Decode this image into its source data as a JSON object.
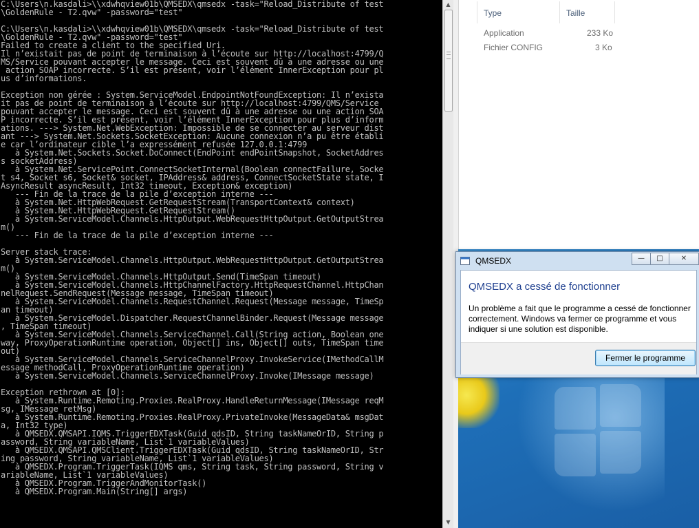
{
  "console": {
    "lines": [
      "C:\\Users\\n.kasdali>\\\\xdwhqview01b\\QMSEDX\\qmsedx -task=\"Reload_Distribute of test",
      "\\GoldenRule - T2.qvw\" -password=\"test\"",
      "",
      "C:\\Users\\n.kasdali>\\\\xdwhqview01b\\QMSEDX\\qmsedx -task=\"Reload_Distribute of test",
      "\\GoldenRule - T2.qvw\" -password=\"test\"",
      "Failed to create a client to the specified Uri.",
      "Il n’existait pas de point de terminaison à l’écoute sur http://localhost:4799/Q",
      "MS/Service pouvant accepter le message. Ceci est souvent dû à une adresse ou une",
      " action SOAP incorrecte. S’il est présent, voir l’élément InnerException pour pl",
      "us d’informations.",
      "",
      "Exception non gérée : System.ServiceModel.EndpointNotFoundException: Il n’exista",
      "it pas de point de terminaison à l’écoute sur http://localhost:4799/QMS/Service",
      "pouvant accepter le message. Ceci est souvent dû à une adresse ou une action SOA",
      "P incorrecte. S’il est présent, voir l’élément InnerException pour plus d’inform",
      "ations. ---> System.Net.WebException: Impossible de se connecter au serveur dist",
      "ant ---> System.Net.Sockets.SocketException: Aucune connexion n’a pu être établi",
      "e car l’ordinateur cible l’a expressément refusée 127.0.0.1:4799",
      "   à System.Net.Sockets.Socket.DoConnect(EndPoint endPointSnapshot, SocketAddres",
      "s socketAddress)",
      "   à System.Net.ServicePoint.ConnectSocketInternal(Boolean connectFailure, Socke",
      "t s4, Socket s6, Socket& socket, IPAddress& address, ConnectSocketState state, I",
      "AsyncResult asyncResult, Int32 timeout, Exception& exception)",
      "   --- Fin de la trace de la pile d’exception interne ---",
      "   à System.Net.HttpWebRequest.GetRequestStream(TransportContext& context)",
      "   à System.Net.HttpWebRequest.GetRequestStream()",
      "   à System.ServiceModel.Channels.HttpOutput.WebRequestHttpOutput.GetOutputStrea",
      "m()",
      "   --- Fin de la trace de la pile d’exception interne ---",
      "",
      "Server stack trace:",
      "   à System.ServiceModel.Channels.HttpOutput.WebRequestHttpOutput.GetOutputStrea",
      "m()",
      "   à System.ServiceModel.Channels.HttpOutput.Send(TimeSpan timeout)",
      "   à System.ServiceModel.Channels.HttpChannelFactory.HttpRequestChannel.HttpChan",
      "nelRequest.SendRequest(Message message, TimeSpan timeout)",
      "   à System.ServiceModel.Channels.RequestChannel.Request(Message message, TimeSp",
      "an timeout)",
      "   à System.ServiceModel.Dispatcher.RequestChannelBinder.Request(Message message",
      ", TimeSpan timeout)",
      "   à System.ServiceModel.Channels.ServiceChannel.Call(String action, Boolean one",
      "way, ProxyOperationRuntime operation, Object[] ins, Object[] outs, TimeSpan time",
      "out)",
      "   à System.ServiceModel.Channels.ServiceChannelProxy.InvokeService(IMethodCallM",
      "essage methodCall, ProxyOperationRuntime operation)",
      "   à System.ServiceModel.Channels.ServiceChannelProxy.Invoke(IMessage message)",
      "",
      "Exception rethrown at [0]:",
      "   à System.Runtime.Remoting.Proxies.RealProxy.HandleReturnMessage(IMessage reqM",
      "sg, IMessage retMsg)",
      "   à System.Runtime.Remoting.Proxies.RealProxy.PrivateInvoke(MessageData& msgDat",
      "a, Int32 type)",
      "   à QMSEDX.QMSAPI.IQMS.TriggerEDXTask(Guid qdsID, String taskNameOrID, String p",
      "assword, String variableName, List`1 variableValues)",
      "   à QMSEDX.QMSAPI.QMSClient.TriggerEDXTask(Guid qdsID, String taskNameOrID, Str",
      "ing password, String variableName, List`1 variableValues)",
      "   à QMSEDX.Program.TriggerTask(IQMS qms, String task, String password, String v",
      "ariableName, List`1 variableValues)",
      "   à QMSEDX.Program.TriggerAndMonitorTask()",
      "   à QMSEDX.Program.Main(String[] args)"
    ]
  },
  "scrollbar": {
    "up_glyph": "▲",
    "down_glyph": "▼"
  },
  "explorer": {
    "col_type": "Type",
    "col_size": "Taille",
    "rows": [
      {
        "type": "Application",
        "size": "233 Ko"
      },
      {
        "type": "Fichier CONFIG",
        "size": "3 Ko"
      }
    ]
  },
  "dialog": {
    "title": "QMSEDX",
    "heading": "QMSEDX a cessé de fonctionner",
    "message": "Un problème a fait que le programme a cessé de fonctionner correctement. Windows va fermer ce programme et vous indiquer si une solution est disponible.",
    "button": "Fermer le programme",
    "minimize_glyph": "—",
    "maximize_glyph": "□",
    "close_glyph": "✕",
    "icon": "app-window-icon"
  },
  "colors": {
    "console_bg": "#000000",
    "console_fg": "#c0c0c0",
    "dialog_heading": "#1e3f8f",
    "desktop": "#1e6fb8"
  }
}
